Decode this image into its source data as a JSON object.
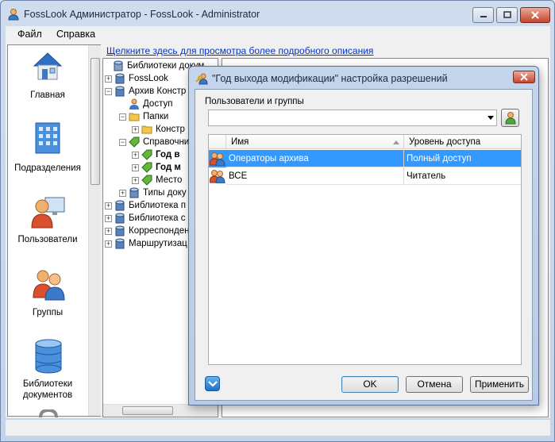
{
  "window": {
    "title": "FossLook Администратор - FossLook - Administrator"
  },
  "menu": {
    "items": [
      "Файл",
      "Справка"
    ]
  },
  "sidebar": {
    "items": [
      {
        "label": "Главная",
        "icon": "home-icon"
      },
      {
        "label": "Подразделения",
        "icon": "building-icon"
      },
      {
        "label": "Пользователи",
        "icon": "user-computer-icon"
      },
      {
        "label": "Группы",
        "icon": "users-icon"
      },
      {
        "label": "Библиотеки документов",
        "icon": "database-icon"
      }
    ]
  },
  "details_link": "Щелкните здесь для просмотра более подробного описания",
  "tree": {
    "nodes": [
      {
        "label": "Библиотеки докум",
        "icon": "library-icon",
        "expander": "",
        "bold": false
      },
      {
        "label": "FossLook",
        "icon": "database-icon",
        "expander": "+",
        "bold": false
      },
      {
        "label": "Архив Констр",
        "icon": "database-icon",
        "expander": "−",
        "bold": false
      },
      {
        "label": "Доступ",
        "icon": "user-icon",
        "expander": "",
        "bold": false
      },
      {
        "label": "Папки",
        "icon": "folder-icon",
        "expander": "−",
        "bold": false
      },
      {
        "label": "Констр",
        "icon": "folder-icon",
        "expander": "+",
        "bold": false
      },
      {
        "label": "Справочни",
        "icon": "tag-icon",
        "expander": "−",
        "bold": false
      },
      {
        "label": "Год в",
        "icon": "tag-icon",
        "expander": "+",
        "bold": true
      },
      {
        "label": "Год м",
        "icon": "tag-icon",
        "expander": "+",
        "bold": true
      },
      {
        "label": "Место",
        "icon": "tag-icon",
        "expander": "+",
        "bold": false
      },
      {
        "label": "Типы доку",
        "icon": "doc-types-icon",
        "expander": "+",
        "bold": false
      },
      {
        "label": "Библиотека п",
        "icon": "database-icon",
        "expander": "+",
        "bold": false
      },
      {
        "label": "Библиотека с",
        "icon": "database-icon",
        "expander": "+",
        "bold": false
      },
      {
        "label": "Корреспонден",
        "icon": "database-icon",
        "expander": "+",
        "bold": false
      },
      {
        "label": "Маршрутизац",
        "icon": "database-icon",
        "expander": "+",
        "bold": false
      }
    ]
  },
  "dialog": {
    "title": "\"Год выхода модификации\" настройка разрешений",
    "group_label": "Пользователи и группы",
    "combo_value": "",
    "columns": [
      "Имя",
      "Уровень доступа"
    ],
    "rows": [
      {
        "name": "Операторы архива",
        "level": "Полный доступ",
        "selected": true
      },
      {
        "name": "ВСЕ",
        "level": "Читатель",
        "selected": false
      }
    ],
    "buttons": {
      "ok": "OK",
      "cancel": "Отмена",
      "apply": "Применить"
    }
  },
  "colors": {
    "selection": "#3399ff",
    "link": "#0033cc",
    "close_button": "#c5452c"
  }
}
